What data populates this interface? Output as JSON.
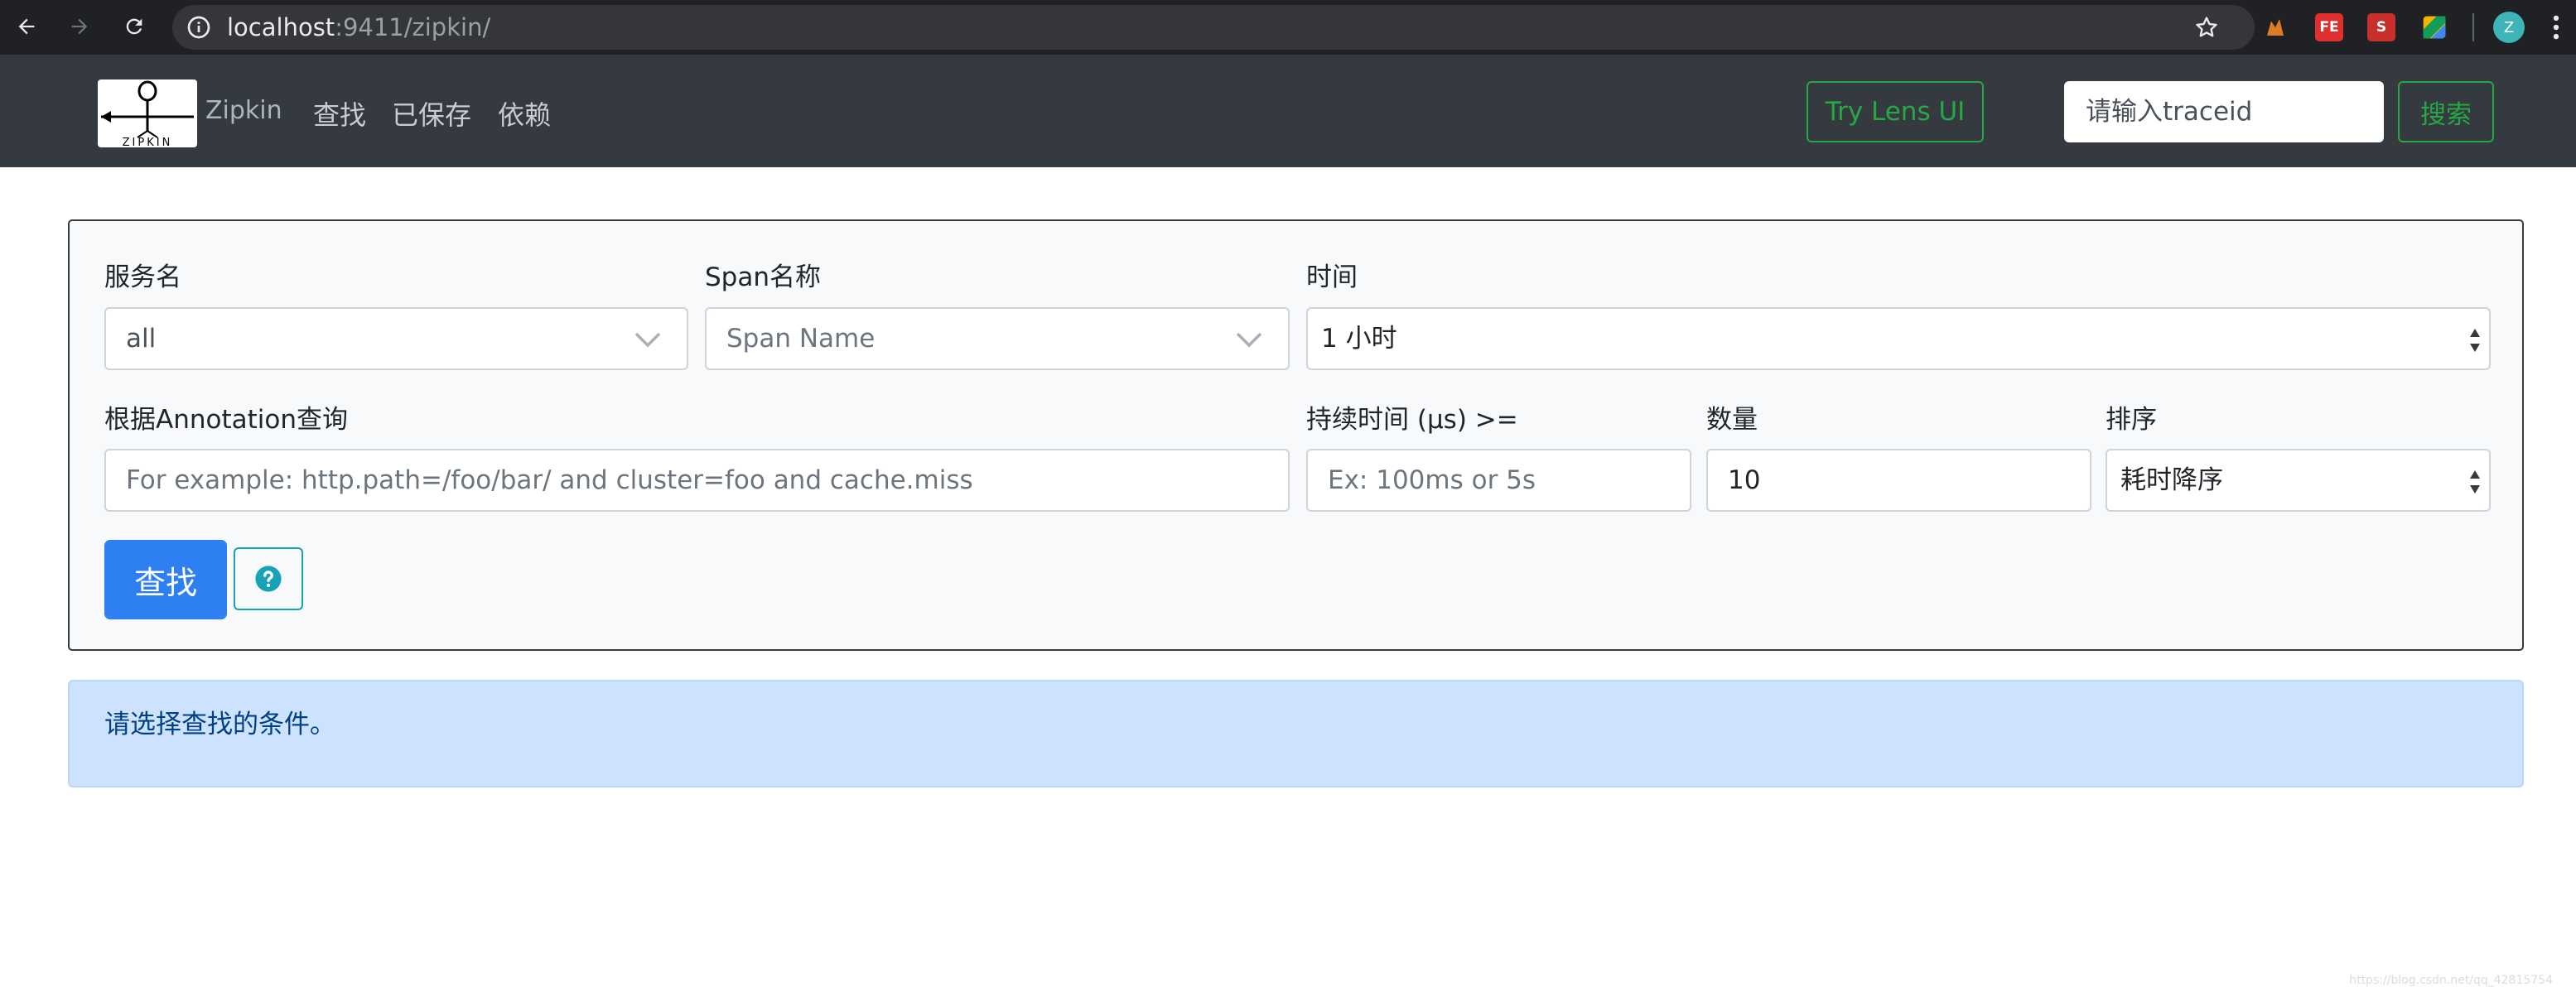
{
  "browser": {
    "url_host": "localhost",
    "url_rest": ":9411/zipkin/",
    "profile_initial": "Z",
    "extensions": [
      {
        "name": "fox-extension",
        "glyph": "",
        "color": "#e07b25"
      },
      {
        "name": "fe-extension",
        "glyph": "FE",
        "color": "#e02f2f"
      },
      {
        "name": "s-extension",
        "glyph": "S",
        "color": "#c8302c"
      },
      {
        "name": "drive-extension",
        "glyph": "",
        "color": "#f4b400"
      }
    ]
  },
  "navbar": {
    "logo_text": "ZIPKIN",
    "brand": "Zipkin",
    "links": [
      "查找",
      "已保存",
      "依赖"
    ],
    "lens_button": "Try Lens UI",
    "traceid_placeholder": "请输入traceid",
    "search_button": "搜索"
  },
  "form": {
    "service": {
      "label": "服务名",
      "value": "all"
    },
    "span": {
      "label": "Span名称",
      "placeholder": "Span Name"
    },
    "time": {
      "label": "时间",
      "value": "1 小时"
    },
    "annotation": {
      "label": "根据Annotation查询",
      "placeholder": "For example: http.path=/foo/bar/ and cluster=foo and cache.miss"
    },
    "duration": {
      "label": "持续时间 (μs) >=",
      "placeholder": "Ex: 100ms or 5s"
    },
    "limit": {
      "label": "数量",
      "value": "10"
    },
    "sort": {
      "label": "排序",
      "value": "耗时降序"
    },
    "find_button": "查找"
  },
  "alert": {
    "text": "请选择查找的条件。"
  },
  "watermark": "https://blog.csdn.net/qq_42815754",
  "colors": {
    "accent_blue": "#2e7ff2",
    "green": "#28a745",
    "navbar": "#343a40",
    "alert_bg": "#cce2ff"
  }
}
